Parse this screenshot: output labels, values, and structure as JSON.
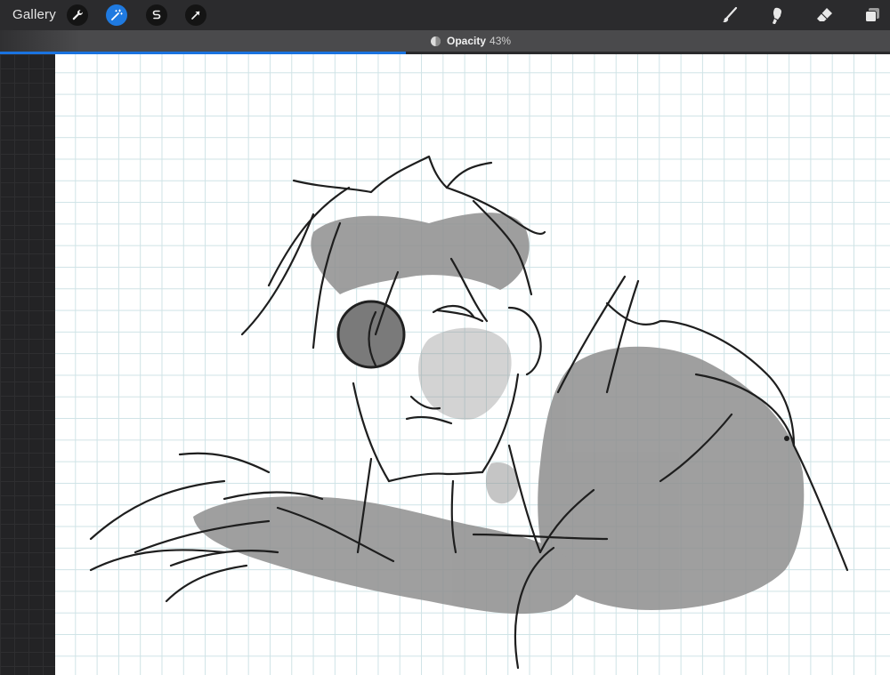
{
  "topbar": {
    "gallery_label": "Gallery",
    "left_tools": [
      "wrench-icon",
      "magic-wand-icon",
      "selection-s-icon",
      "transform-arrow-icon"
    ],
    "active_tool": "magic-wand-icon",
    "right_tools": [
      "brush-icon",
      "smudge-icon",
      "eraser-icon",
      "layers-icon"
    ]
  },
  "opacity": {
    "label": "Opacity",
    "value": "43%",
    "fraction": 0.456
  },
  "colors": {
    "accent": "#1a73e0",
    "toolbar": "#2b2b2d",
    "canvas_grid": "#cfe3e6"
  }
}
